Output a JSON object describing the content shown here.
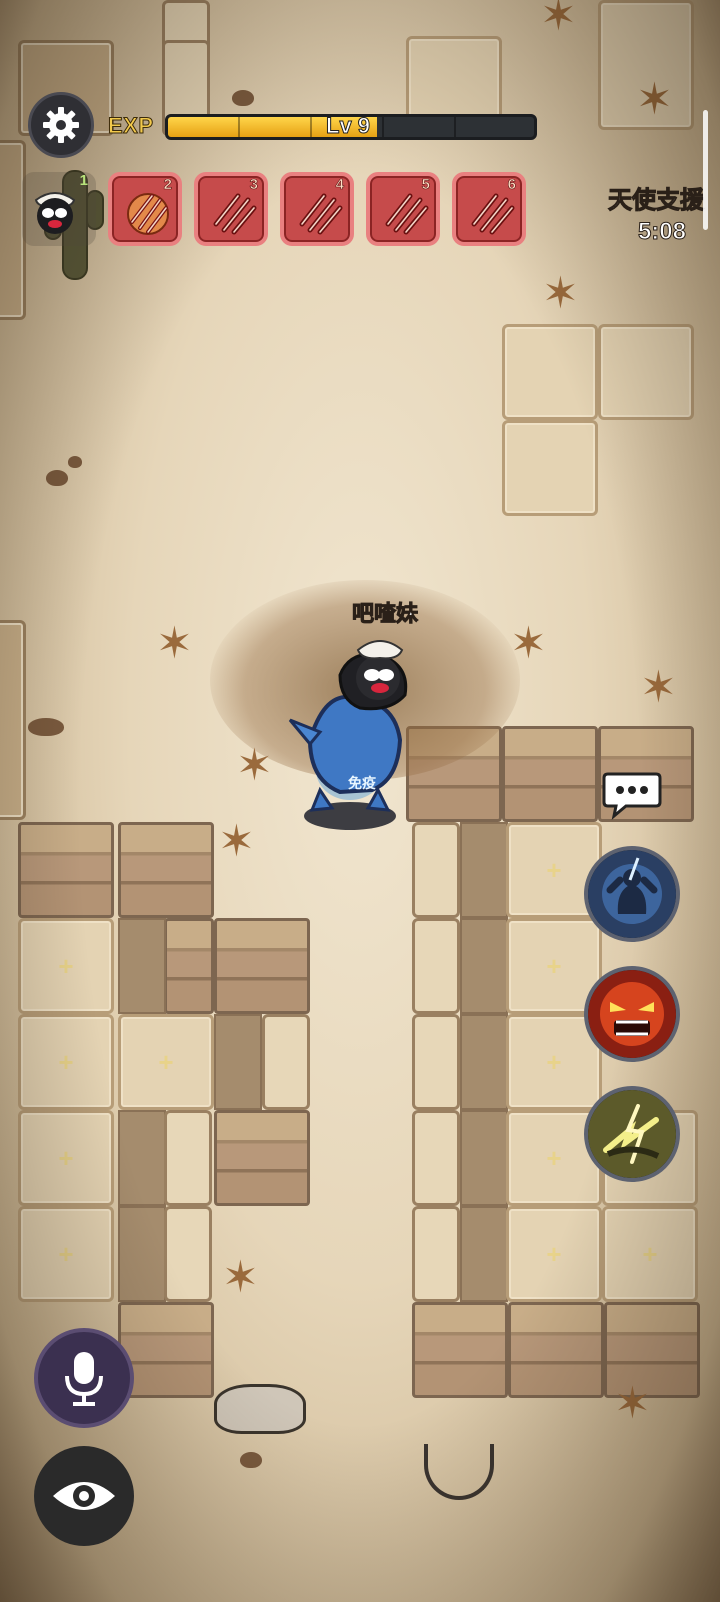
{
  "hud": {
    "exp_label": "EXP",
    "level_label": "Lv 9",
    "exp_progress": 0.57
  },
  "skill_slots": [
    {
      "number": "1",
      "kind": "character"
    },
    {
      "number": "2",
      "kind": "claw-orb"
    },
    {
      "number": "3",
      "kind": "claw"
    },
    {
      "number": "4",
      "kind": "claw"
    },
    {
      "number": "5",
      "kind": "claw"
    },
    {
      "number": "6",
      "kind": "claw"
    }
  ],
  "support": {
    "title": "天使支援",
    "timer": "5:08"
  },
  "player": {
    "name": "吧喳妹",
    "status": "免疫"
  },
  "abilities": [
    {
      "name": "aura-power",
      "color": "#4b7fc4"
    },
    {
      "name": "rage-face",
      "color": "#d6441e"
    },
    {
      "name": "lightning",
      "color": "#e8e06a"
    }
  ],
  "colors": {
    "exp_fill": "#f2b525",
    "slot_red": "#c64b4b",
    "ground": "#e9dcc3"
  }
}
